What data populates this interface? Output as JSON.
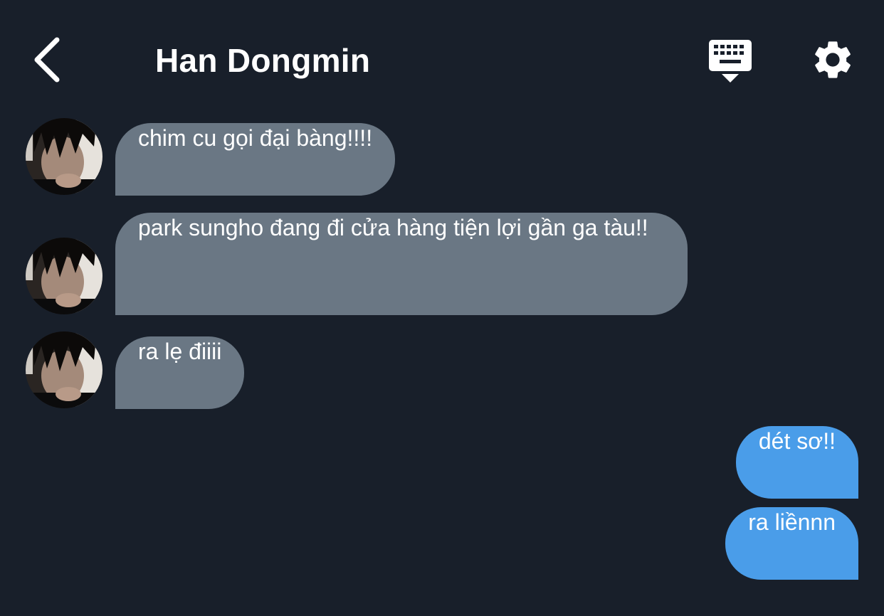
{
  "header": {
    "title": "Han Dongmin",
    "back_icon": "chevron-left-icon",
    "keyboard_icon": "keyboard-hide-icon",
    "settings_icon": "gear-icon"
  },
  "colors": {
    "background": "#181f2a",
    "incoming_bubble": "#6a7784",
    "outgoing_bubble": "#4a9de9",
    "text": "#ffffff"
  },
  "messages": [
    {
      "direction": "incoming",
      "text": "chim cu gọi đại bàng!!!!"
    },
    {
      "direction": "incoming",
      "text": "park sungho đang đi cửa hàng tiện lợi gần ga tàu!!"
    },
    {
      "direction": "incoming",
      "text": "ra lẹ điiii"
    },
    {
      "direction": "outgoing",
      "text": "dét sơ!!"
    },
    {
      "direction": "outgoing",
      "text": "ra liềnnn"
    }
  ]
}
